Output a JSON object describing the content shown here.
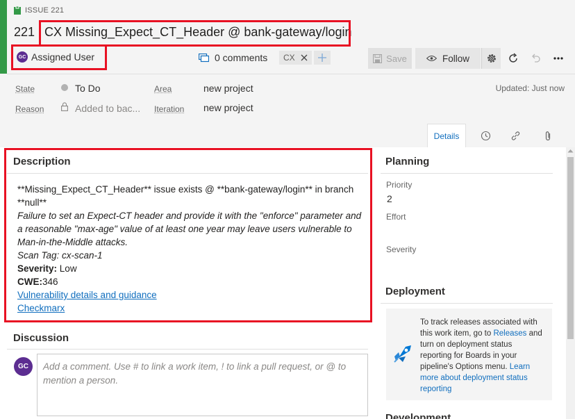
{
  "work_item": {
    "type_label": "ISSUE 221",
    "id": "221",
    "title": "CX Missing_Expect_CT_Header @ bank-gateway/login",
    "assigned_initials": "GC",
    "assigned_user": "Assigned User",
    "comments": "0 comments",
    "tag": "CX"
  },
  "toolbar": {
    "save_label": "Save",
    "follow_label": "Follow"
  },
  "fields": {
    "state_label": "State",
    "state_value": "To Do",
    "reason_label": "Reason",
    "reason_value": "Added to bac...",
    "area_label": "Area",
    "area_value": "new project",
    "iteration_label": "Iteration",
    "iteration_value": "new project",
    "updated": "Updated: Just now"
  },
  "tabs": {
    "details": "Details"
  },
  "description": {
    "title": "Description",
    "line1": "**Missing_Expect_CT_Header** issue exists @ **bank-gateway/login** in branch",
    "line2": "**null**",
    "line3": "Failure to set an Expect-CT header and provide it with the \"enforce\" parameter and",
    "line4": "a reasonable \"max-age\" value of at least one year may leave users vulnerable to",
    "line5": "Man-in-the-Middle attacks.",
    "line6": "Scan Tag: cx-scan-1",
    "severity_label": "Severity:",
    "severity_value": " Low",
    "cwe_label": "CWE:",
    "cwe_value": "346",
    "link1": "Vulnerability details and guidance",
    "link2": "Checkmarx"
  },
  "discussion": {
    "title": "Discussion",
    "avatar_initials": "GC",
    "placeholder": "Add a comment. Use # to link a work item, ! to link a pull request, or @ to mention a person."
  },
  "planning": {
    "title": "Planning",
    "priority_label": "Priority",
    "priority_value": "2",
    "effort_label": "Effort",
    "severity_label": "Severity"
  },
  "deployment": {
    "title": "Deployment",
    "text_a": "To track releases associated with this work item, go to ",
    "link_releases": "Releases",
    "text_b": " and turn on deployment status reporting for Boards in your pipeline's Options menu. ",
    "link_learn": "Learn more about deployment status reporting"
  },
  "development": {
    "title": "Development"
  },
  "colors": {
    "accent_green": "#339947",
    "highlight_red": "#e81123",
    "link_blue": "#106ebe",
    "avatar_purple": "#5c2d91"
  }
}
